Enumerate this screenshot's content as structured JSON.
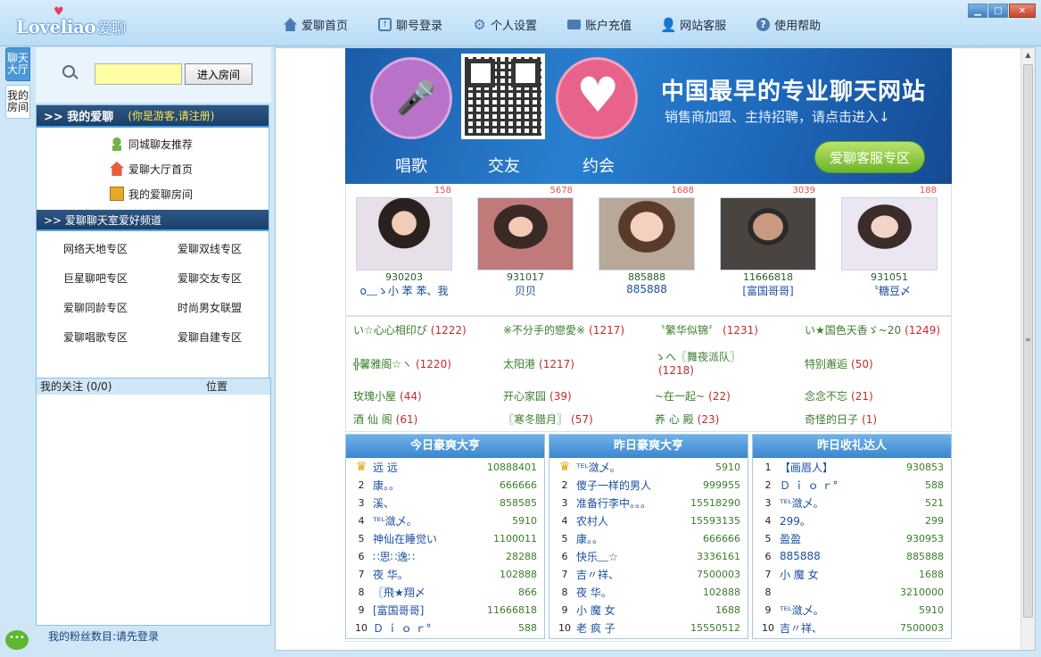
{
  "app": {
    "logo_en": "Loveliao",
    "logo_cn": "爱聊"
  },
  "topnav": [
    {
      "label": "爱聊首页",
      "icon": "home-icon"
    },
    {
      "label": "聊号登录",
      "icon": "login-icon"
    },
    {
      "label": "个人设置",
      "icon": "gear-icon"
    },
    {
      "label": "账户充值",
      "icon": "card-icon"
    },
    {
      "label": "网站客服",
      "icon": "support-icon"
    },
    {
      "label": "使用帮助",
      "icon": "help-icon"
    }
  ],
  "vtabs": [
    {
      "label": "聊天大厅",
      "active": true
    },
    {
      "label": "我的房间",
      "active": false
    }
  ],
  "search": {
    "value": "",
    "button": "进入房间"
  },
  "my": {
    "title": ">> 我的爱聊",
    "guest_note": "(你是游客,请注册)"
  },
  "quick_links": [
    {
      "label": "同城聊友推荐",
      "icon": "friend-icon"
    },
    {
      "label": "爱聊大厅首页",
      "icon": "house-icon"
    },
    {
      "label": "我的爱聊房间",
      "icon": "book-icon"
    }
  ],
  "channel_title": ">> 爱聊聊天室爱好频道",
  "zones": [
    "网络天地专区",
    "爱聊双线专区",
    "巨星聊吧专区",
    "爱聊交友专区",
    "爱聊同龄专区",
    "时尚男女联盟",
    "爱聊唱歌专区",
    "爱聊自建专区"
  ],
  "follow": {
    "label": "我的关注 (0/0)",
    "pos_label": "位置"
  },
  "fans": "我的粉丝数目:请先登录",
  "banner": {
    "labels": [
      "唱歌",
      "交友",
      "约会"
    ],
    "headline": "中国最早的专业聊天网站",
    "sub": "销售商加盟、主持招聘，请点击进入↓",
    "button": "爱聊客服专区"
  },
  "anchors": [
    {
      "count": "158",
      "room": "930203",
      "nick": "о﹏ゝ小 苯 苯、我"
    },
    {
      "count": "5678",
      "room": "931017",
      "nick": "贝贝"
    },
    {
      "count": "1688",
      "room": "885888",
      "nick": "885888"
    },
    {
      "count": "3039",
      "room": "11666818",
      "nick": "[富国哥哥]"
    },
    {
      "count": "188",
      "room": "931051",
      "nick": "〝糖豆〆"
    }
  ],
  "rooms": [
    {
      "name": "い☆心心相印ぴ",
      "n": "(1222)"
    },
    {
      "name": "※不分手的戀愛※",
      "n": "(1217)"
    },
    {
      "name": "〝繁华似锦〞",
      "n": "(1231)"
    },
    {
      "name": "い★国色天香ゞ~20",
      "n": "(1249)"
    },
    {
      "name": "╬馨雅阁☆ヽ",
      "n": "(1220)"
    },
    {
      "name": "太阳港",
      "n": "(1217)"
    },
    {
      "name": "ゝへ〖舞夜派队〗",
      "n": "(1218)"
    },
    {
      "name": "特别邂逅",
      "n": "(50)"
    },
    {
      "name": "玫瑰小屋",
      "n": "(44)"
    },
    {
      "name": "开心家园",
      "n": "(39)"
    },
    {
      "name": "~在一起~",
      "n": "(22)"
    },
    {
      "name": "念念不忘",
      "n": "(21)"
    },
    {
      "name": "酒 仙 阁",
      "n": "(61)"
    },
    {
      "name": "〖寒冬腊月〗",
      "n": "(57)"
    },
    {
      "name": "养 心 殿",
      "n": "(23)"
    },
    {
      "name": "奇怪的日子",
      "n": "(1)"
    }
  ],
  "ranks": [
    {
      "title": "今日豪爽大亨",
      "rows": [
        {
          "i": "♛",
          "nm": "远 远",
          "v": "10888401"
        },
        {
          "i": "2",
          "nm": "康。。",
          "v": "666666"
        },
        {
          "i": "3",
          "nm": "溪、",
          "v": "858585"
        },
        {
          "i": "4",
          "nm": "ᵀᴱᴸ潋乄。",
          "v": "5910"
        },
        {
          "i": "5",
          "nm": "神仙在睡觉い",
          "v": "1100011"
        },
        {
          "i": "6",
          "nm": "∷思∷逸∷",
          "v": "28288"
        },
        {
          "i": "7",
          "nm": "夜 华。",
          "v": "102888"
        },
        {
          "i": "8",
          "nm": "〖飛★翔〆",
          "v": "866"
        },
        {
          "i": "9",
          "nm": "[富国哥哥]",
          "v": "11666818"
        },
        {
          "i": "10",
          "nm": "Ｄ ｉ ｏ ｒ°",
          "v": "588"
        }
      ]
    },
    {
      "title": "昨日豪爽大亨",
      "rows": [
        {
          "i": "♛",
          "nm": "ᵀᴱᴸ潋乄。",
          "v": "5910"
        },
        {
          "i": "2",
          "nm": "傻子一样的男人",
          "v": "999955"
        },
        {
          "i": "3",
          "nm": "准备行李中。。。",
          "v": "15518290"
        },
        {
          "i": "4",
          "nm": "农村人",
          "v": "15593135"
        },
        {
          "i": "5",
          "nm": "康。。",
          "v": "666666"
        },
        {
          "i": "6",
          "nm": "快乐﹏☆",
          "v": "3336161"
        },
        {
          "i": "7",
          "nm": "吉〃祥、",
          "v": "7500003"
        },
        {
          "i": "8",
          "nm": "夜 华。",
          "v": "102888"
        },
        {
          "i": "9",
          "nm": "小 魔 女",
          "v": "1688"
        },
        {
          "i": "10",
          "nm": "老 疯 子",
          "v": "15550512"
        }
      ]
    },
    {
      "title": "昨日收礼达人",
      "rows": [
        {
          "i": "1",
          "nm": "【画眉人】",
          "v": "930853"
        },
        {
          "i": "2",
          "nm": "Ｄ ｉ ｏ ｒ°",
          "v": "588"
        },
        {
          "i": "3",
          "nm": "ᵀᴱᴸ潋乄。",
          "v": "521"
        },
        {
          "i": "4",
          "nm": "299。",
          "v": "299"
        },
        {
          "i": "5",
          "nm": "盈盈",
          "v": "930953"
        },
        {
          "i": "6",
          "nm": "885888",
          "v": "885888"
        },
        {
          "i": "7",
          "nm": "小 魔 女",
          "v": "1688"
        },
        {
          "i": "8",
          "nm": "",
          "v": "3210000"
        },
        {
          "i": "9",
          "nm": "ᵀᴱᴸ潋乄。",
          "v": "5910"
        },
        {
          "i": "10",
          "nm": "吉〃祥、",
          "v": "7500003"
        }
      ]
    }
  ]
}
